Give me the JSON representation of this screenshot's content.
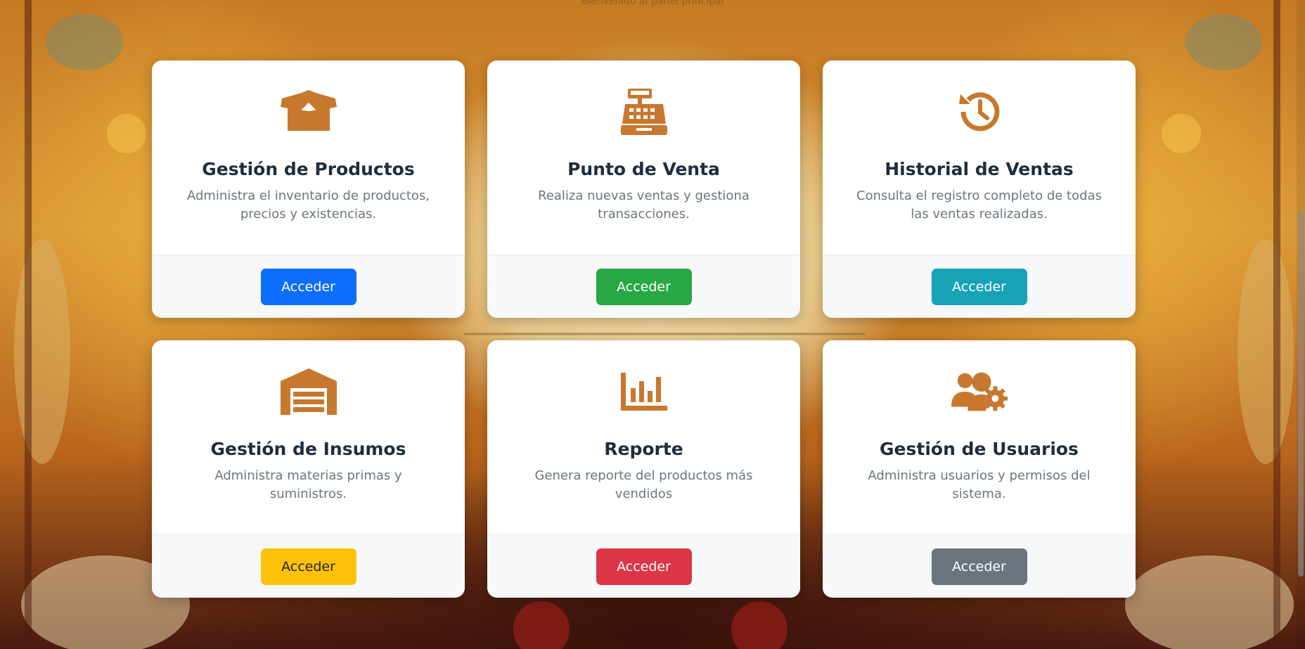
{
  "accent_icon_color": "#c8782e",
  "header": {
    "subtitle_partial": "Bienvenido al panel principal"
  },
  "cards": [
    {
      "title": "Gestión de Productos",
      "description": "Administra el inventario de productos, precios y existencias.",
      "icon": "box-open-icon",
      "button_label": "Acceder",
      "button_color": "#0d6efd"
    },
    {
      "title": "Punto de Venta",
      "description": "Realiza nuevas ventas y gestiona transacciones.",
      "icon": "cash-register-icon",
      "button_label": "Acceder",
      "button_color": "#28a745"
    },
    {
      "title": "Historial de Ventas",
      "description": "Consulta el registro completo de todas las ventas realizadas.",
      "icon": "history-icon",
      "button_label": "Acceder",
      "button_color": "#17a2b8"
    },
    {
      "title": "Gestión de Insumos",
      "description": "Administra materias primas y suministros.",
      "icon": "warehouse-icon",
      "button_label": "Acceder",
      "button_color": "#ffc107"
    },
    {
      "title": "Reporte",
      "description": "Genera reporte del productos más vendidos",
      "icon": "chart-bar-icon",
      "button_label": "Acceder",
      "button_color": "#dc3545"
    },
    {
      "title": "Gestión de Usuarios",
      "description": "Administra usuarios y permisos del sistema.",
      "icon": "users-cog-icon",
      "button_label": "Acceder",
      "button_color": "#6c757d"
    }
  ]
}
